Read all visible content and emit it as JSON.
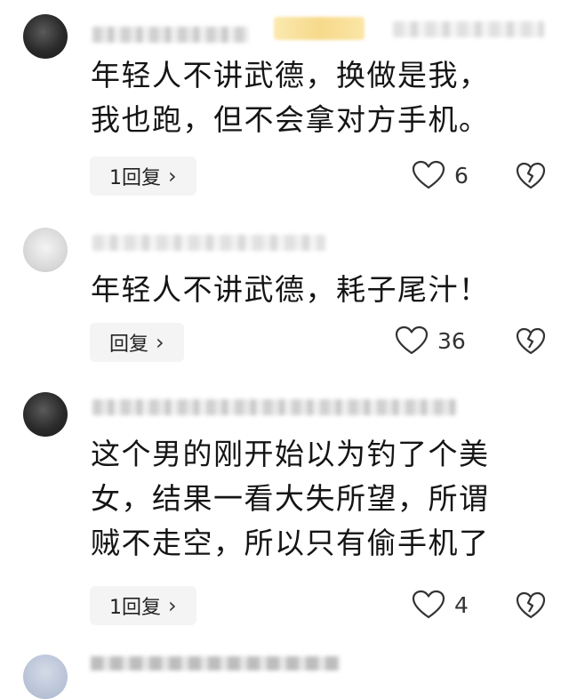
{
  "comments": [
    {
      "lines": [
        "年轻人不讲武德，换做是我，",
        "我也跑，但不会拿对方手机。"
      ],
      "reply_label": "1回复",
      "likes": "6",
      "avatar_icon": "avatar-dark-portrait"
    },
    {
      "lines": [
        "年轻人不讲武德，耗子尾汁！"
      ],
      "reply_label": "回复",
      "likes": "36",
      "avatar_icon": "avatar-light-blurred"
    },
    {
      "lines": [
        "这个男的刚开始以为钓了个美",
        "女，结果一看大失所望，所谓",
        "贼不走空，所以只有偷手机了"
      ],
      "reply_label": "1回复",
      "likes": "4",
      "avatar_icon": "avatar-dark-portrait"
    }
  ],
  "icons": {
    "chevron": "›",
    "like": "heart-outline-icon",
    "dislike": "broken-heart-icon"
  },
  "colors": {
    "text": "#151515",
    "reply_bg": "#f4f4f4",
    "icon_stroke": "#333333"
  }
}
